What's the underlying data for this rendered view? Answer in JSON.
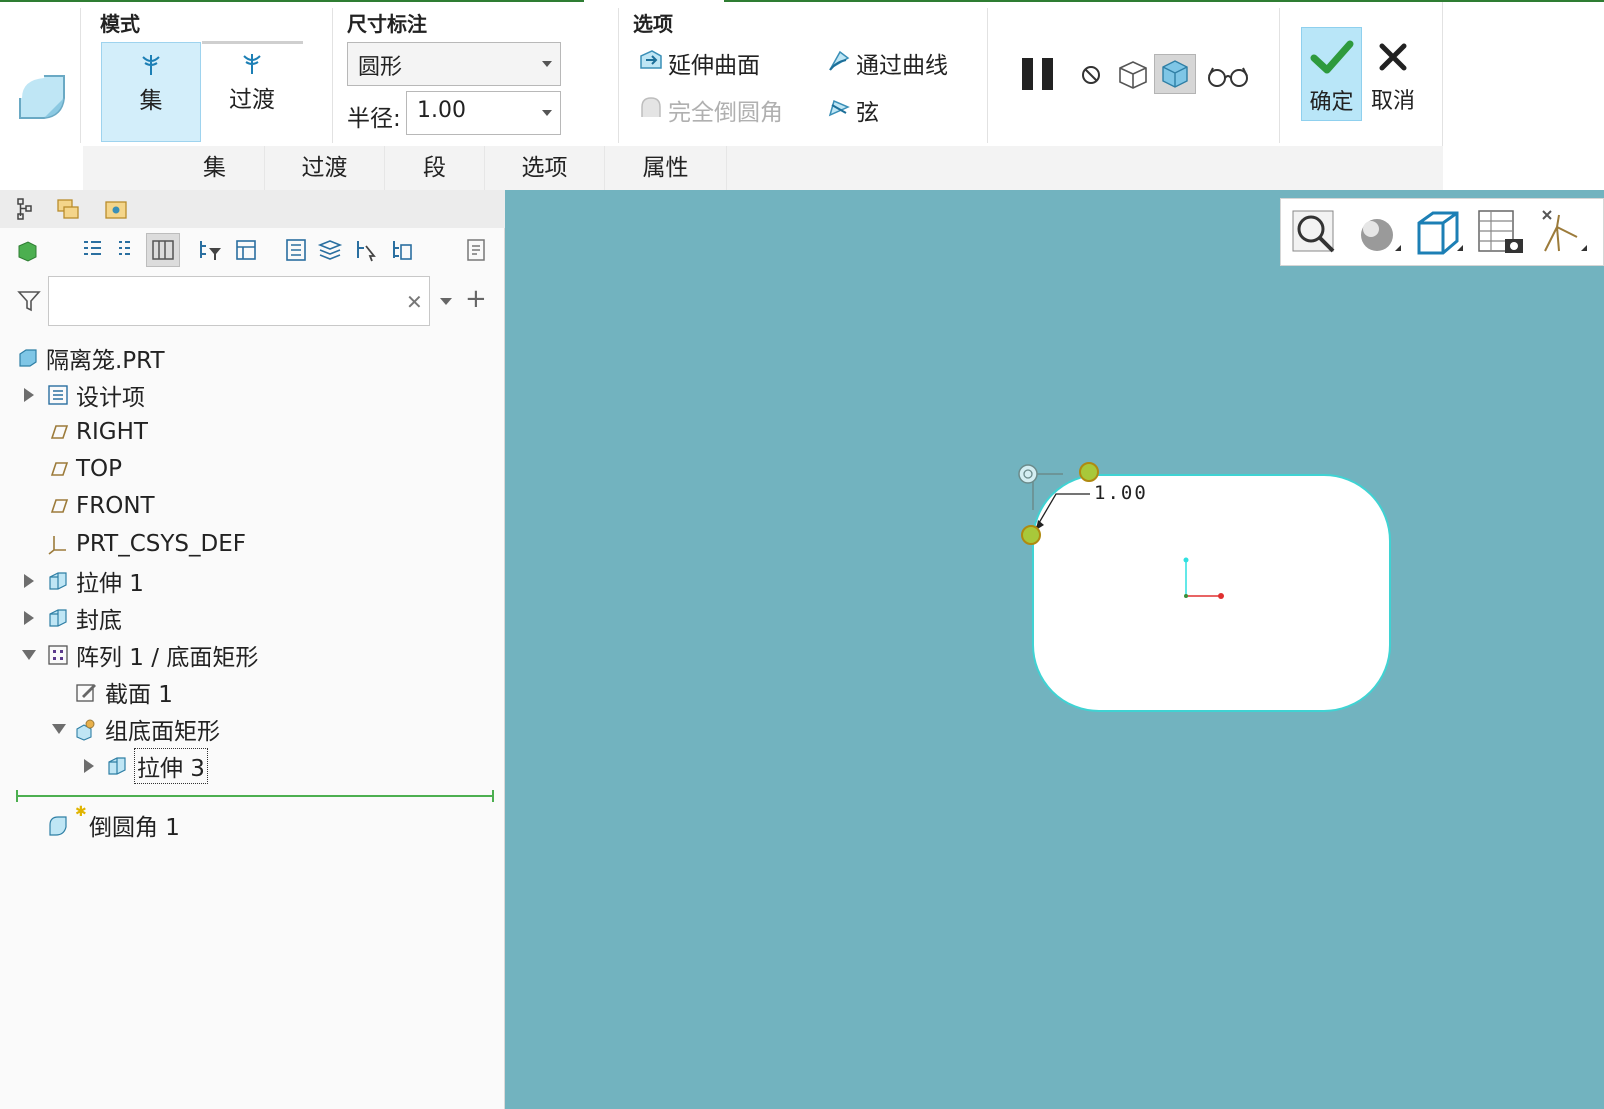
{
  "ribbon": {
    "groups": {
      "mode": "模式",
      "dimension": "尺寸标注",
      "options": "选项"
    },
    "mode_buttons": [
      {
        "label": "集",
        "active": true
      },
      {
        "label": "过渡",
        "active": false
      }
    ],
    "dimension": {
      "shape_value": "圆形",
      "radius_label": "半径:",
      "radius_value": "1.00"
    },
    "options": {
      "extend_surface": "延伸曲面",
      "through_curve": "通过曲线",
      "full_round": "完全倒圆角",
      "chord": "弦"
    },
    "actions": {
      "ok": "确定",
      "cancel": "取消"
    },
    "tabs": [
      "集",
      "过渡",
      "段",
      "选项",
      "属性"
    ]
  },
  "model_tree": {
    "search_placeholder": "",
    "items": [
      {
        "label": "隔离笼.PRT",
        "icon": "part-icon"
      },
      {
        "label": "设计项",
        "icon": "design-items-icon"
      },
      {
        "label": "RIGHT",
        "icon": "datum-plane-icon"
      },
      {
        "label": "TOP",
        "icon": "datum-plane-icon"
      },
      {
        "label": "FRONT",
        "icon": "datum-plane-icon"
      },
      {
        "label": "PRT_CSYS_DEF",
        "icon": "csys-icon"
      },
      {
        "label": "拉伸 1",
        "icon": "extrude-icon"
      },
      {
        "label": "封底",
        "icon": "extrude-icon"
      },
      {
        "label": "阵列 1 / 底面矩形",
        "icon": "pattern-icon"
      },
      {
        "label": "截面 1",
        "icon": "sketch-icon"
      },
      {
        "label": "组底面矩形",
        "icon": "group-icon"
      },
      {
        "label": "拉伸 3",
        "icon": "extrude-icon"
      },
      {
        "label": "倒圆角 1",
        "icon": "round-icon"
      }
    ]
  },
  "viewport": {
    "dimension_text": "1.00",
    "background": "#72b3bf"
  },
  "colors": {
    "accent": "#2e7d32",
    "active_button": "#d3eefa",
    "ok_button": "#b9e6f8"
  }
}
